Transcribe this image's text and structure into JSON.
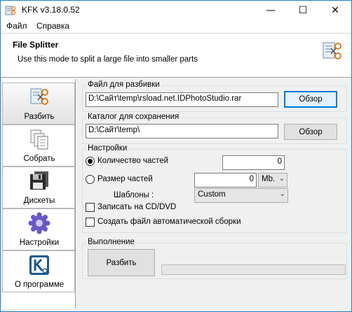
{
  "window": {
    "title": "KFK v3.18.0.52",
    "controls": {
      "minimize": "—",
      "maximize": "☐",
      "close": "✕"
    }
  },
  "menu": {
    "items": [
      "Файл",
      "Справка"
    ]
  },
  "header": {
    "title": "File Splitter",
    "subtitle": "Use this mode to split a large file into smaller parts",
    "icon": "split-file-icon"
  },
  "sidebar": {
    "items": [
      {
        "label": "Разбить",
        "icon": "split-icon",
        "active": true
      },
      {
        "label": "Собрать",
        "icon": "merge-documents-icon",
        "active": false
      },
      {
        "label": "Дискеты",
        "icon": "floppy-disk-icon",
        "active": false
      },
      {
        "label": "Настройки",
        "icon": "settings-gear-icon",
        "active": false
      },
      {
        "label": "О программе",
        "icon": "about-k-icon",
        "active": false
      }
    ]
  },
  "source": {
    "title": "Файл для разбивки",
    "value": "D:\\Сайт\\temp\\rsload.net.IDPhotoStudio.rar",
    "browse_label": "Обзор"
  },
  "target": {
    "title": "Каталог для сохранения",
    "value": "D:\\Сайт\\temp\\",
    "browse_label": "Обзор"
  },
  "settings": {
    "title": "Настройки",
    "parts_count_label": "Количество частей",
    "parts_count_value": "0",
    "parts_count_selected": true,
    "part_size_label": "Размер частей",
    "part_size_value": "0",
    "part_size_unit": "Mb.",
    "templates_label": "Шаблоны :",
    "template_value": "Custom",
    "write_cd_label": "Записать на CD/DVD",
    "write_cd_checked": false,
    "autobuild_label": "Создать файл автоматической сборки",
    "autobuild_checked": false
  },
  "execution": {
    "title": "Выполнение",
    "run_label": "Разбить",
    "progress": 0
  },
  "colors": {
    "window_border": "#1883d7",
    "default_button_border": "#0078d7",
    "progress_fill": "#06b025"
  }
}
